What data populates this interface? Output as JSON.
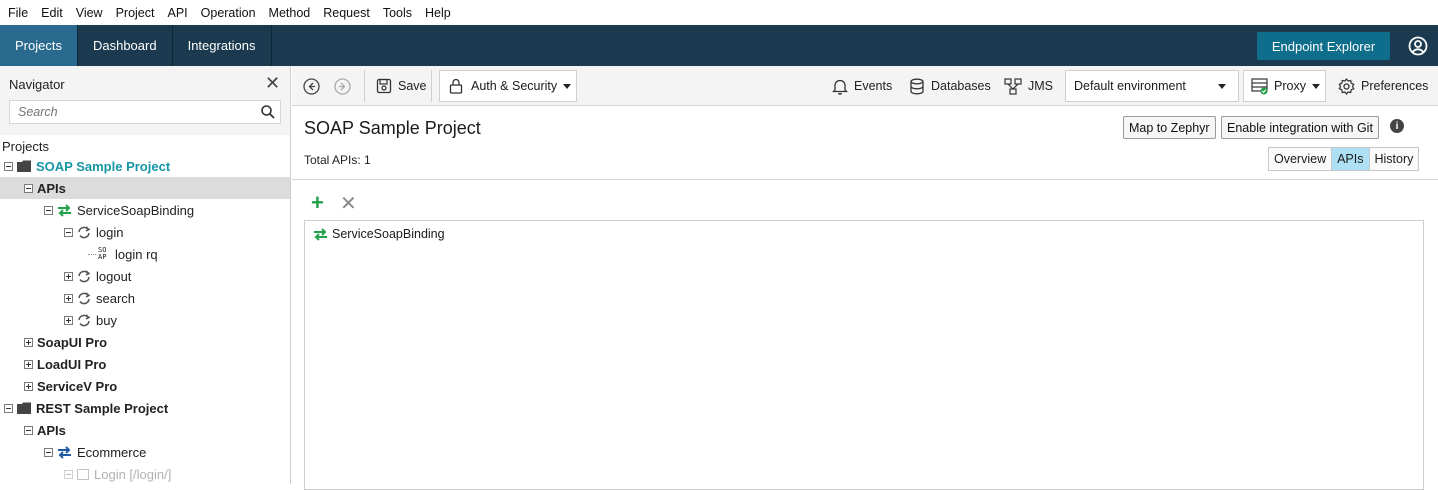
{
  "menubar": {
    "items": [
      "File",
      "Edit",
      "View",
      "Project",
      "API",
      "Operation",
      "Method",
      "Request",
      "Tools",
      "Help"
    ]
  },
  "topnav": {
    "tabs": [
      "Projects",
      "Dashboard",
      "Integrations"
    ],
    "active_tab": "Projects",
    "endpoint_explorer": "Endpoint Explorer"
  },
  "navigator": {
    "title": "Navigator",
    "search_placeholder": "Search",
    "root_label": "Projects",
    "tree": [
      {
        "label": "SOAP Sample Project",
        "style": "teal-bold"
      },
      {
        "label": "APIs",
        "style": "bold",
        "selected": true
      },
      {
        "label": "ServiceSoapBinding"
      },
      {
        "label": "login"
      },
      {
        "label": "login rq"
      },
      {
        "label": "logout"
      },
      {
        "label": "search"
      },
      {
        "label": "buy"
      },
      {
        "label": "SoapUI Pro",
        "style": "bold"
      },
      {
        "label": "LoadUI Pro",
        "style": "bold"
      },
      {
        "label": "ServiceV Pro",
        "style": "bold"
      },
      {
        "label": "REST Sample Project",
        "style": "bold"
      },
      {
        "label": "APIs",
        "style": "bold"
      },
      {
        "label": "Ecommerce"
      },
      {
        "label": "Login [/login/]"
      }
    ]
  },
  "toolbar": {
    "save": "Save",
    "auth": "Auth & Security",
    "events": "Events",
    "databases": "Databases",
    "jms": "JMS",
    "environment": "Default environment",
    "proxy": "Proxy",
    "preferences": "Preferences"
  },
  "main": {
    "title": "SOAP Sample Project",
    "total": "Total APIs: 1",
    "map_zephyr": "Map to Zephyr",
    "enable_git": "Enable integration with Git",
    "tabs": [
      "Overview",
      "APIs",
      "History"
    ],
    "active_tab": "APIs",
    "api_items": [
      "ServiceSoapBinding"
    ]
  },
  "colors": {
    "topnav_bg": "#1b3a4f",
    "active_tab": "#2a6a8e",
    "accent_teal": "#1696a6",
    "add_green": "#22a04a"
  }
}
